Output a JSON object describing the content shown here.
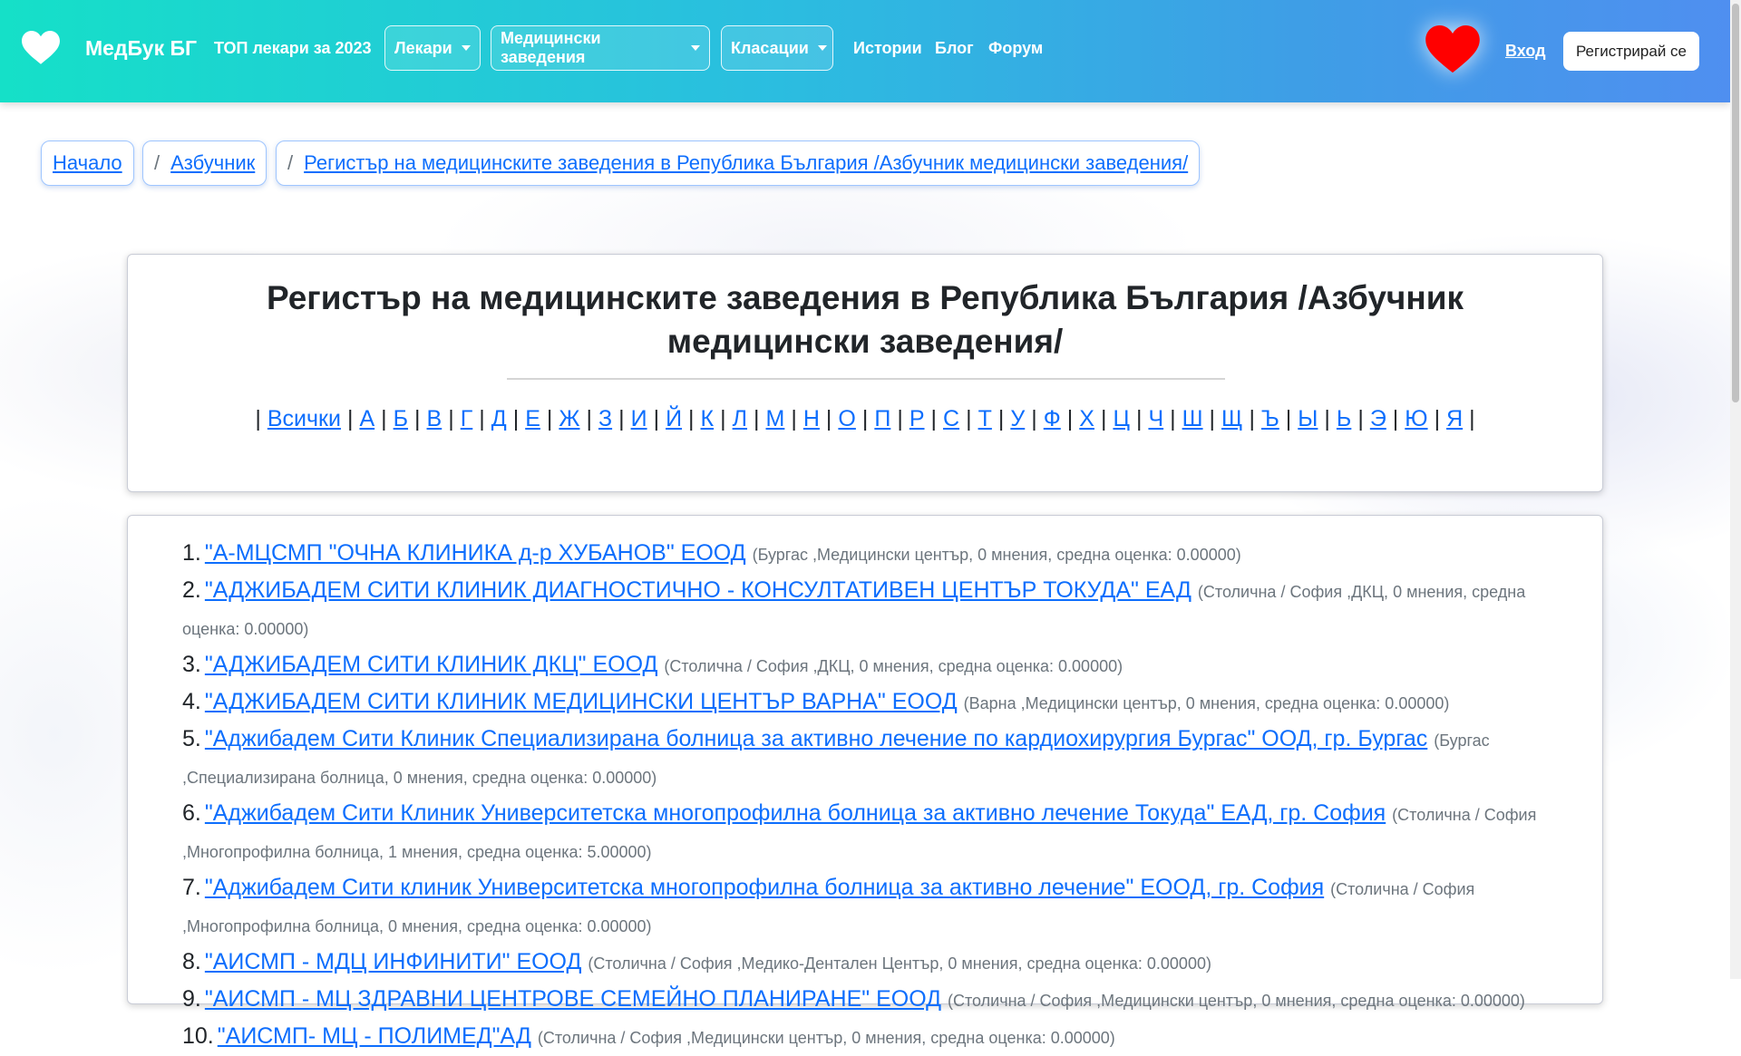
{
  "nav": {
    "brand": "МедБук БГ",
    "top_doctors": "ТОП лекари за 2023",
    "doctors": "Лекари",
    "facilities": "Медицински заведения",
    "rankings": "Класации",
    "stories": "Истории",
    "blog": "Блог",
    "forum": "Форум",
    "login": "Вход",
    "register": "Регистрирай се",
    "heart_color": "#ff0000"
  },
  "breadcrumb": {
    "home": "Начало",
    "sep": "/",
    "alphabet": "Азбучник",
    "current": "Регистър на медицинските заведения в Република България /Азбучник медицински заведения/"
  },
  "title": {
    "line1": "Регистър на медицинските заведения в Република България /Азбучник",
    "line2": "медицински заведения/"
  },
  "alphabet": [
    "Всички",
    "А",
    "Б",
    "В",
    "Г",
    "Д",
    "Е",
    "Ж",
    "З",
    "И",
    "Й",
    "К",
    "Л",
    "М",
    "Н",
    "О",
    "П",
    "Р",
    "С",
    "Т",
    "У",
    "Ф",
    "Х",
    "Ц",
    "Ч",
    "Ш",
    "Щ",
    "Ъ",
    "Ы",
    "Ь",
    "Э",
    "Ю",
    "Я"
  ],
  "facilities": [
    {
      "num": "1.",
      "name": "\"А-МЦСМП \"ОЧНА КЛИНИКА д-р ХУБАНОВ\" ЕООД",
      "meta": "(Бургас ,Медицински център, 0 мнения, средна оценка: 0.00000)"
    },
    {
      "num": "2.",
      "name": "\"АДЖИБАДЕМ СИТИ КЛИНИК ДИАГНОСТИЧНО - КОНСУЛТАТИВЕН ЦЕНТЪР ТОКУДА\" ЕАД",
      "meta": "(Столична / София ,ДКЦ, 0 мнения, средна оценка: 0.00000)"
    },
    {
      "num": "3.",
      "name": "\"АДЖИБАДЕМ СИТИ КЛИНИК ДКЦ\" ЕООД",
      "meta": "(Столична / София ,ДКЦ, 0 мнения, средна оценка: 0.00000)"
    },
    {
      "num": "4.",
      "name": "\"АДЖИБАДЕМ СИТИ КЛИНИК МЕДИЦИНСКИ ЦЕНТЪР ВАРНА\" ЕООД",
      "meta": "(Варна ,Медицински център, 0 мнения, средна оценка: 0.00000)"
    },
    {
      "num": "5.",
      "name": "\"Аджибадем Сити Клиник Специализирана болница за активно лечение по кардиохирургия Бургас\" ООД, гр. Бургас",
      "meta": "(Бургас ,Специализирана болница, 0 мнения, средна оценка: 0.00000)"
    },
    {
      "num": "6.",
      "name": "\"Аджибадем Сити Клиник Университетска многопрофилна болница за активно лечение Токуда\" ЕАД, гр. София",
      "meta": "(Столична / София ,Многопрофилна болница, 1 мнения, средна оценка: 5.00000)"
    },
    {
      "num": "7.",
      "name": "\"Аджибадем Сити клиник Университетска многопрофилна болница за активно лечение\" ЕООД, гр. София",
      "meta": "(Столична / София ,Многопрофилна болница, 0 мнения, средна оценка: 0.00000)"
    },
    {
      "num": "8.",
      "name": "\"АИСМП - МДЦ ИНФИНИТИ\" ЕООД",
      "meta": "(Столична / София ,Медико-Дентален Център, 0 мнения, средна оценка: 0.00000)"
    },
    {
      "num": "9.",
      "name": "\"АИСМП - МЦ ЗДРАВНИ ЦЕНТРОВЕ СЕМЕЙНО ПЛАНИРАНЕ\" ЕООД",
      "meta": "(Столична / София ,Медицински център, 0 мнения, средна оценка: 0.00000)"
    },
    {
      "num": "10.",
      "name": "\"АИСМП- МЦ - ПОЛИМЕД\"АД",
      "meta": "(Столична / София ,Медицински център, 0 мнения, средна оценка: 0.00000)"
    }
  ]
}
